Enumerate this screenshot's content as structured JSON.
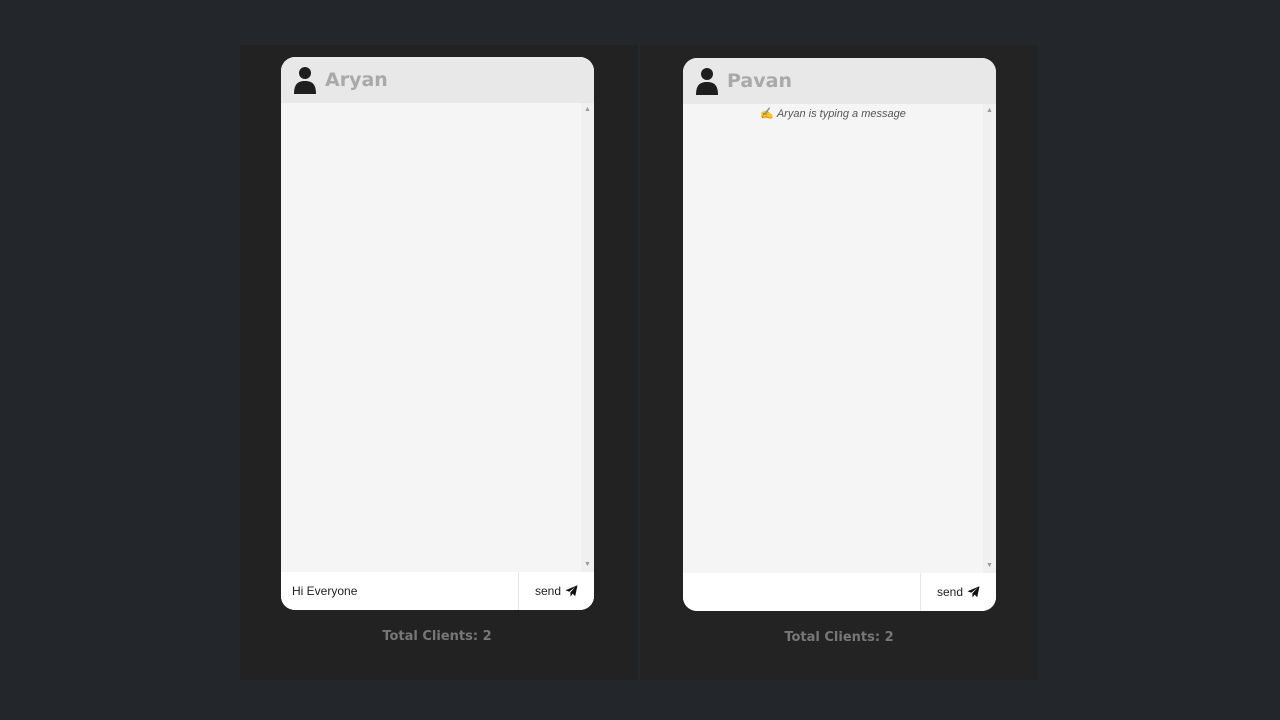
{
  "clients": [
    {
      "name": "Aryan",
      "typing_indicator": "",
      "input_value": "Hi Everyone",
      "input_placeholder": "",
      "send_label": "send",
      "total_clients_label": "Total Clients: 2"
    },
    {
      "name": "Pavan",
      "typing_emoji": "✍",
      "typing_indicator": "Aryan is typing a message",
      "input_value": "",
      "input_placeholder": "",
      "send_label": "send",
      "total_clients_label": "Total Clients: 2"
    }
  ],
  "icons": {
    "user": "user-icon",
    "send": "paper-plane-icon",
    "scroll_up": "scroll-up-arrow",
    "scroll_down": "scroll-down-arrow"
  },
  "colors": {
    "background": "#23262b",
    "panel": "#222222",
    "chat_body": "#f5f5f5",
    "chat_header": "#e8e8e8",
    "name_text": "#a9a9a9",
    "total_text": "#777777"
  }
}
